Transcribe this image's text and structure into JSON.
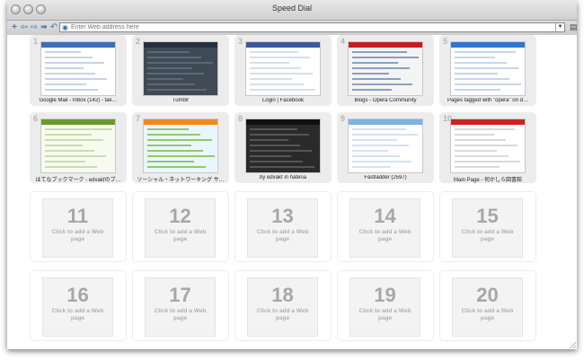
{
  "window": {
    "title": "Speed Dial"
  },
  "toolbar": {
    "address_placeholder": "Enter Web address here",
    "buttons": [
      "plus-icon",
      "back-icon",
      "forward-icon",
      "fast-forward-icon",
      "reload-icon"
    ]
  },
  "speed_dial": {
    "items": [
      {
        "number": "1",
        "caption": "Google Mail - Inbox (142) - tak…",
        "filled": true,
        "theme": "gmail"
      },
      {
        "number": "2",
        "caption": "Tumblr",
        "filled": true,
        "theme": "tumblr"
      },
      {
        "number": "3",
        "caption": "Login | Facebook",
        "filled": true,
        "theme": "facebook"
      },
      {
        "number": "4",
        "caption": "Blogs - Opera Community",
        "filled": true,
        "theme": "opera"
      },
      {
        "number": "5",
        "caption": "Pages tagged with \"opera\" on d…",
        "filled": true,
        "theme": "delicious"
      },
      {
        "number": "6",
        "caption": "はてなブックマーク - edvakfのブ…",
        "filled": true,
        "theme": "hatena"
      },
      {
        "number": "7",
        "caption": "ソーシャル・ネットワーキング サ…",
        "filled": true,
        "theme": "mixi"
      },
      {
        "number": "8",
        "caption": "by edvakf in hatena",
        "filled": true,
        "theme": "dark"
      },
      {
        "number": "9",
        "caption": "Fastladder (2597)",
        "filled": true,
        "theme": "fastladder"
      },
      {
        "number": "10",
        "caption": "Main Page - 何かしら図書館",
        "filled": true,
        "theme": "wiki"
      },
      {
        "number": "11",
        "caption": "Click to add a Web page",
        "filled": false
      },
      {
        "number": "12",
        "caption": "Click to add a Web page",
        "filled": false
      },
      {
        "number": "13",
        "caption": "Click to add a Web page",
        "filled": false
      },
      {
        "number": "14",
        "caption": "Click to add a Web page",
        "filled": false
      },
      {
        "number": "15",
        "caption": "Click to add a Web page",
        "filled": false
      },
      {
        "number": "16",
        "caption": "Click to add a Web page",
        "filled": false
      },
      {
        "number": "17",
        "caption": "Click to add a Web page",
        "filled": false
      },
      {
        "number": "18",
        "caption": "Click to add a Web page",
        "filled": false
      },
      {
        "number": "19",
        "caption": "Click to add a Web page",
        "filled": false
      },
      {
        "number": "20",
        "caption": "Click to add a Web page",
        "filled": false
      }
    ]
  }
}
